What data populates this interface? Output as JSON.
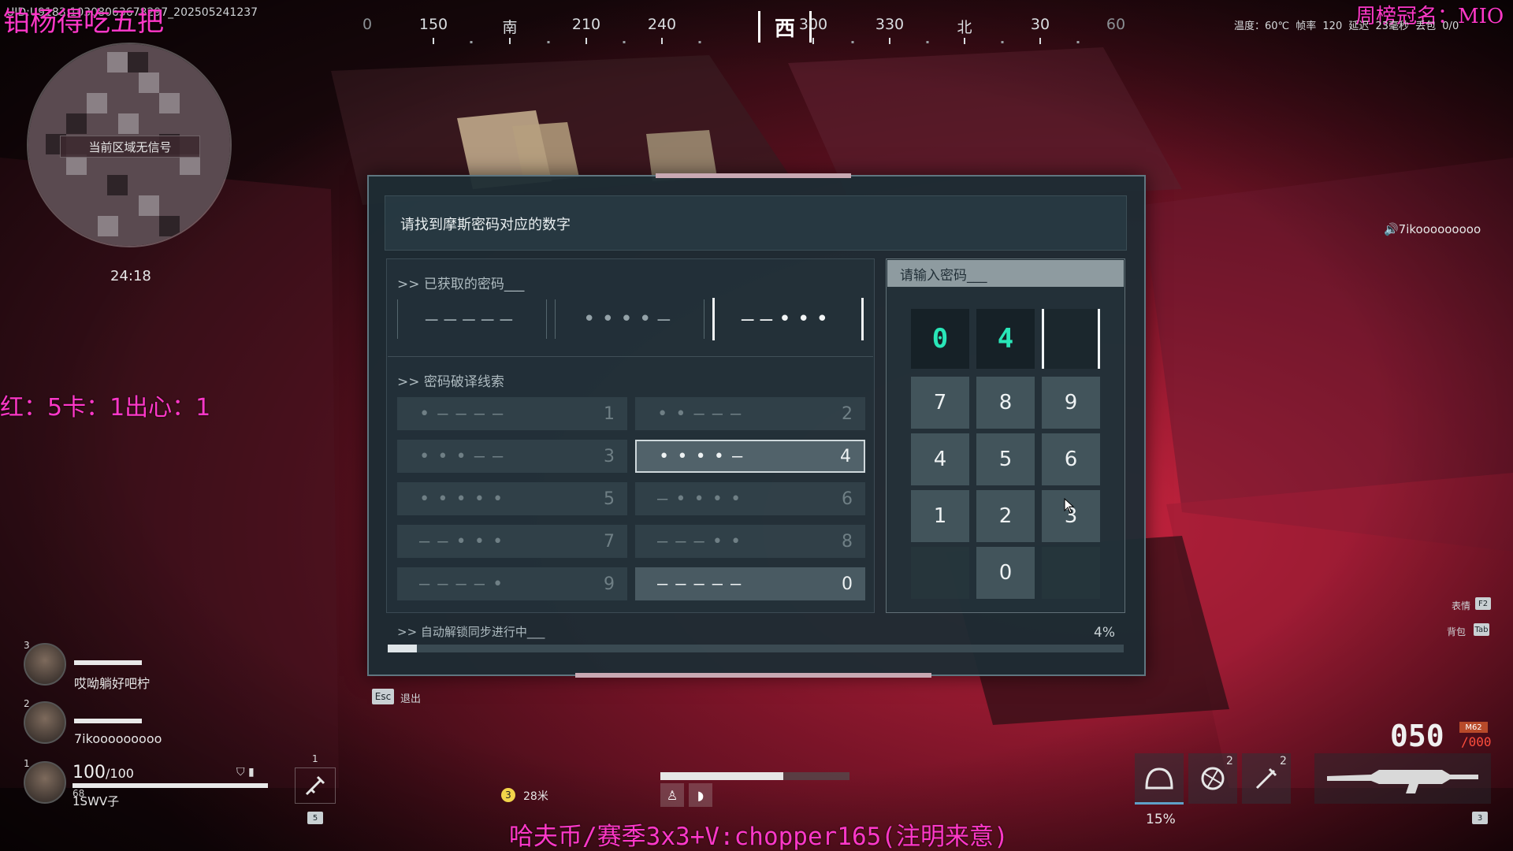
{
  "hud": {
    "uid_text": "UID:U9183:10308063678297_202505241237",
    "streamer_overlay": "铂杨得吃五把",
    "ranking_overlay": "周榜冠名：MIO",
    "stats_overlay": "红：5卡：1出心：1",
    "bottom_overlay": "哈夫币/赛季3x3+V:chopper165(注明来意)",
    "topright_info": "温度：60℃  帧率 120  延迟 23毫秒  丢包 0/0",
    "minimap_status": "当前区域无信号",
    "timer": "24:18",
    "voice_user": "🔊7ikooooooooo",
    "compass": {
      "marks": [
        "0",
        "150",
        "南",
        "210",
        "240",
        "300",
        "330",
        "北",
        "30",
        "60"
      ],
      "current": "西"
    },
    "distance": "28米",
    "objective_number": "3"
  },
  "panel": {
    "title": "请找到摩斯密码对应的数字",
    "obtained_label": ">> 已获取的密码___",
    "obtained_codes": [
      "—————",
      "••••—",
      "——•••"
    ],
    "clues_label": ">> 密码破译线索",
    "clues": [
      {
        "pattern": "•————",
        "digit": "1"
      },
      {
        "pattern": "••———",
        "digit": "2"
      },
      {
        "pattern": "•••——",
        "digit": "3"
      },
      {
        "pattern": "••••—",
        "digit": "4"
      },
      {
        "pattern": "•••••",
        "digit": "5"
      },
      {
        "pattern": "—••••",
        "digit": "6"
      },
      {
        "pattern": "——•••",
        "digit": "7"
      },
      {
        "pattern": "———••",
        "digit": "8"
      },
      {
        "pattern": "————•",
        "digit": "9"
      },
      {
        "pattern": "—————",
        "digit": "0"
      }
    ],
    "highlighted_clue_digit": "4",
    "selected_clue_digit": "0",
    "input_placeholder": "请输入密码___",
    "entered": [
      "0",
      "4",
      ""
    ],
    "keypad": [
      "7",
      "8",
      "9",
      "4",
      "5",
      "6",
      "1",
      "2",
      "3",
      "",
      "0",
      ""
    ],
    "sync_label": ">> 自动解锁同步进行中___",
    "sync_progress": 4,
    "sync_percent_text": "4%",
    "esc_key": "Esc",
    "esc_label": "退出"
  },
  "hints": [
    {
      "label": "表情",
      "key": "F2"
    },
    {
      "label": "背包",
      "key": "Tab"
    }
  ],
  "team": [
    {
      "slot": "3",
      "name": "哎呦躺好吧柠"
    },
    {
      "slot": "2",
      "name": "7ikooooooooo"
    },
    {
      "slot": "1",
      "name": "1SWV子",
      "hp": "100",
      "hp_max": "/100",
      "hp_sub": "68"
    }
  ],
  "quick_slot": {
    "top": "1",
    "key": "5"
  },
  "equipment": {
    "percent": "15%",
    "grenade_count": "2",
    "knife_count": "2",
    "weapon_key": "3"
  },
  "weapon": {
    "ammo": "050",
    "reserve": "/000",
    "ammo_type": "M62"
  }
}
